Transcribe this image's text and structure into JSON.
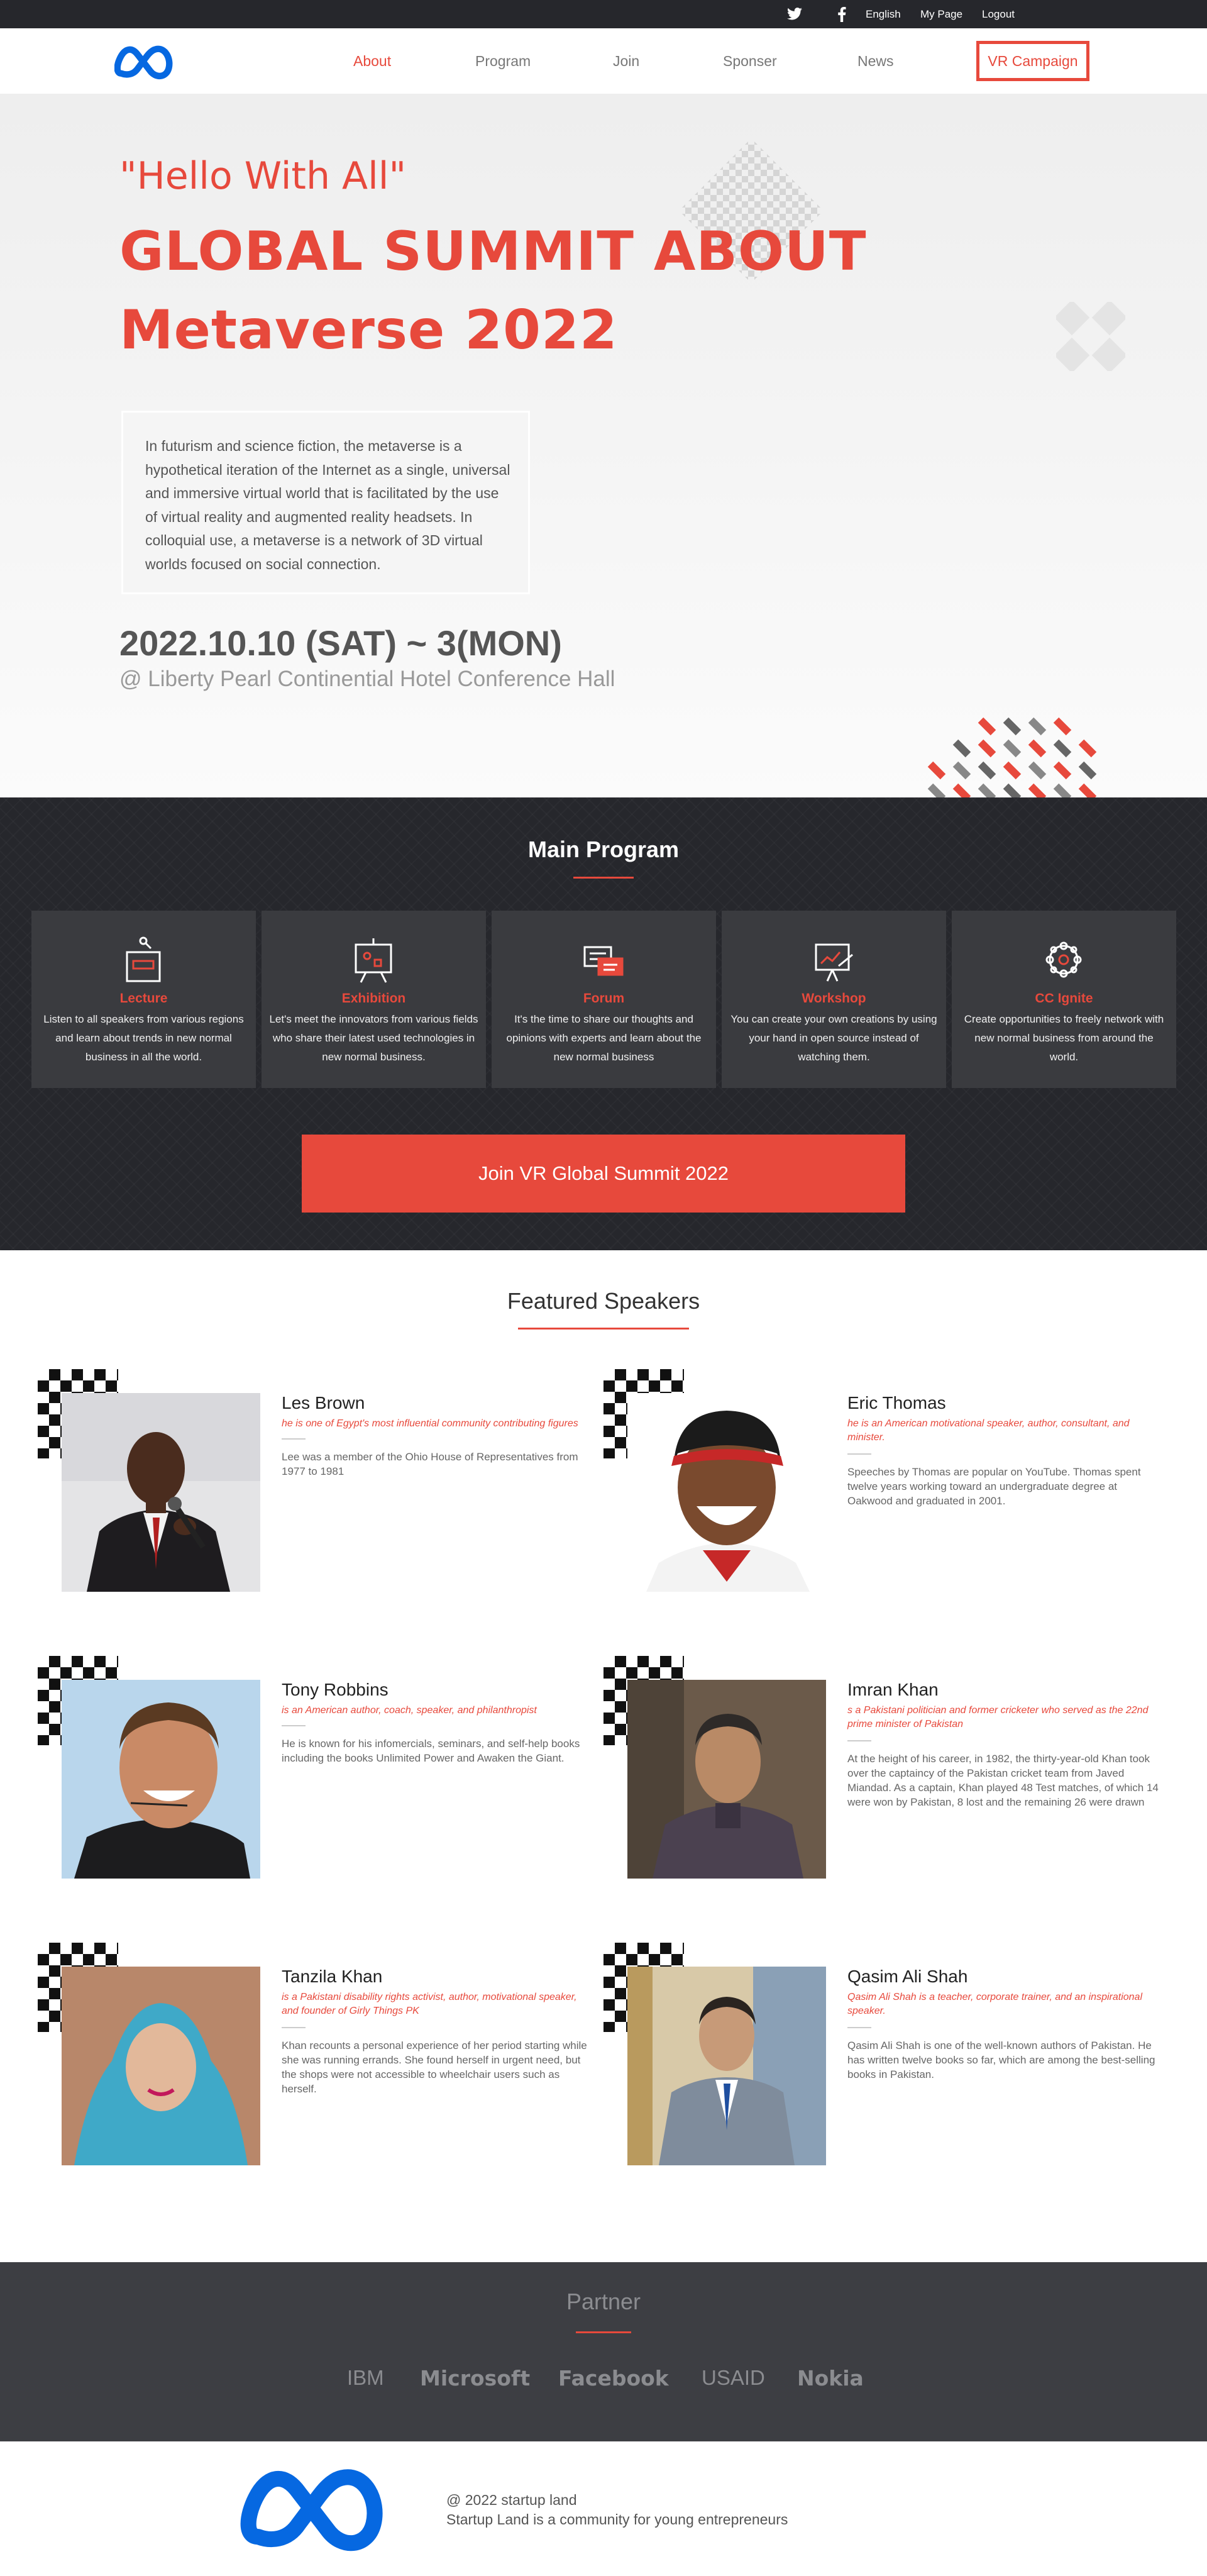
{
  "topbar": {
    "language": "English",
    "my_page": "My Page",
    "logout": "Logout"
  },
  "nav": {
    "items": [
      "About",
      "Program",
      "Join",
      "Sponser",
      "News"
    ],
    "active": "About",
    "cta": "VR Campaign"
  },
  "hero": {
    "tagline": "\"Hello With All\"",
    "title_line1": "GLOBAL SUMMIT ABOUT",
    "title_line2": "Metaverse 2022",
    "description": "In futurism and science fiction, the metaverse is a hypothetical iteration of the Internet as a single, universal and immersive virtual world that is facilitated by the use of virtual reality and augmented reality headsets. In colloquial use, a metaverse is a network of 3D virtual worlds focused on social connection.",
    "date": "2022.10.10 (SAT) ~ 3(MON)",
    "venue": "@ Liberty Pearl Continential Hotel Conference Hall"
  },
  "program": {
    "title": "Main Program",
    "cards": [
      {
        "title": "Lecture",
        "desc": "Listen to all speakers from various regions and learn about trends in new normal business in all the world.",
        "icon": "podium-icon"
      },
      {
        "title": "Exhibition",
        "desc": "Let's meet the innovators from various fields who share their latest used technologies in new normal business.",
        "icon": "easel-icon"
      },
      {
        "title": "Forum",
        "desc": "It's the time to share our thoughts and opinions with experts and learn about the new normal business",
        "icon": "chat-icon"
      },
      {
        "title": "Workshop",
        "desc": "You can create your own creations by using your hand in open source instead of watching them.",
        "icon": "presentation-icon"
      },
      {
        "title": "CC Ignite",
        "desc": "Create opportunities to freely network with new normal business from around the world.",
        "icon": "network-icon"
      }
    ],
    "join_button": "Join VR Global Summit 2022"
  },
  "speakers": {
    "title": "Featured Speakers",
    "items": [
      {
        "name": "Les Brown",
        "role": "he is one of Egypt's most influential community contributing figures",
        "bio": "Lee was a member of the Ohio House of Representatives from 1977 to 1981"
      },
      {
        "name": "Eric Thomas",
        "role": "he is an American motivational speaker, author, consultant, and minister.",
        "bio": "Speeches by Thomas are popular on YouTube. Thomas spent twelve years working toward an undergraduate degree at Oakwood and graduated in 2001."
      },
      {
        "name": "Tony Robbins",
        "role": "is an American author, coach, speaker, and philanthropist",
        "bio": "He is known for his infomercials, seminars, and self-help books including the books Unlimited Power and Awaken the Giant."
      },
      {
        "name": "Imran Khan",
        "role": "s a Pakistani politician and former cricketer who served as the 22nd prime minister of Pakistan",
        "bio": "At the height of his career, in 1982, the thirty-year-old Khan took over the captaincy of the Pakistan cricket team from Javed Miandad. As a captain, Khan played 48 Test matches, of which 14 were won by Pakistan, 8 lost and the remaining 26 were drawn"
      },
      {
        "name": "Tanzila Khan",
        "role": "is a Pakistani disability rights activist, author, motivational speaker, and founder of Girly Things PK",
        "bio": "Khan recounts a personal experience of her period starting while she was running errands. She found herself in urgent need, but the shops were not accessible to wheelchair users such as herself."
      },
      {
        "name": "Qasim Ali Shah",
        "role": "Qasim Ali Shah is a teacher, corporate trainer, and an inspirational speaker.",
        "bio": "Qasim Ali Shah is one of the well-known authors of Pakistan. He has written twelve books so far, which are among the best-selling books in Pakistan."
      }
    ]
  },
  "partner": {
    "title": "Partner",
    "logos": [
      "IBM",
      "Microsoft",
      "Facebook",
      "USAID",
      "Nokia"
    ]
  },
  "footer": {
    "copyright": "@ 2022 startup land",
    "tagline": "Startup Land is a community for young entrepreneurs"
  },
  "colors": {
    "accent": "#e7493c",
    "dark": "#26272c",
    "brand_blue": "#0668e1"
  }
}
